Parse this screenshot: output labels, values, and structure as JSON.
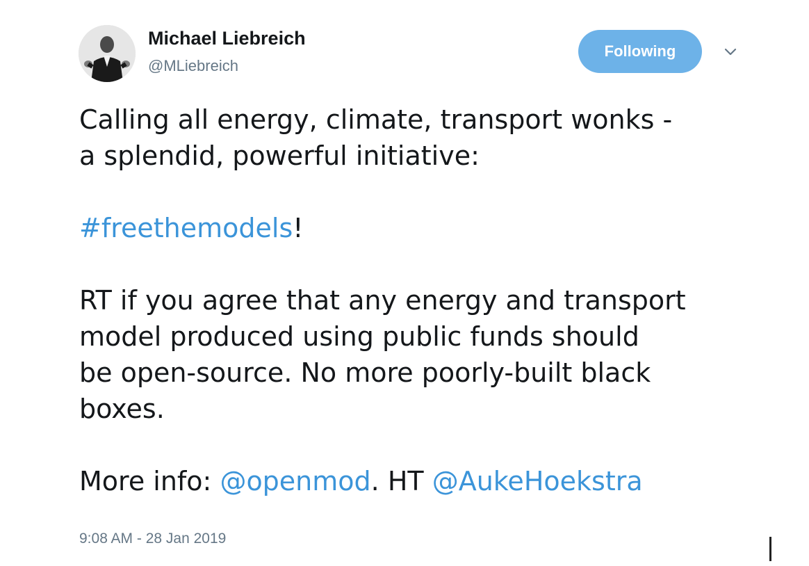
{
  "tweet": {
    "author": {
      "display_name": "Michael Liebreich",
      "handle": "@MLiebreich"
    },
    "follow_button": {
      "label": "Following",
      "color": "#6db2e8"
    },
    "menu_icon": "chevron-down-icon",
    "body": {
      "line1": "Calling all energy, climate, transport wonks -",
      "line2": "a splendid, powerful initiative:",
      "hashtag": "#freethemodels",
      "hashtag_suffix": "!",
      "rt_line1": "RT if you agree that any energy and transport",
      "rt_line2": "model produced using public funds should",
      "rt_line3": "be open-source. No more poorly-built black",
      "rt_line4": "boxes.",
      "info_prefix": "More info: ",
      "mention1": "@openmod",
      "info_middle": ". HT ",
      "mention2": "@AukeHoekstra"
    },
    "timestamp": "9:08 AM - 28 Jan 2019",
    "colors": {
      "link": "#3b94d9",
      "secondary_text": "#657786",
      "primary_text": "#14171a"
    }
  }
}
